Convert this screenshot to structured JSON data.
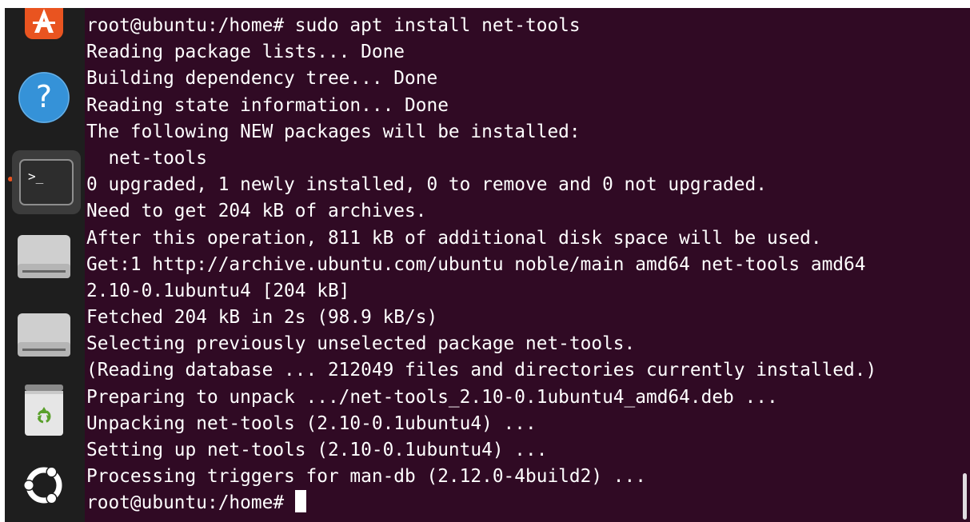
{
  "dock": {
    "items": [
      {
        "name": "app-center",
        "icon": "app-center-icon"
      },
      {
        "name": "help",
        "icon": "help-icon",
        "glyph": "?"
      },
      {
        "name": "terminal",
        "icon": "terminal-icon",
        "glyph": ">_",
        "active": true
      },
      {
        "name": "drive-1",
        "icon": "drive-icon"
      },
      {
        "name": "drive-2",
        "icon": "drive-icon"
      },
      {
        "name": "trash",
        "icon": "trash-icon"
      },
      {
        "name": "show-apps",
        "icon": "ubuntu-logo-icon"
      }
    ]
  },
  "terminal": {
    "prompt": "root@ubuntu:/home# ",
    "lines": [
      "root@ubuntu:/home# sudo apt install net-tools",
      "Reading package lists... Done",
      "Building dependency tree... Done",
      "Reading state information... Done",
      "The following NEW packages will be installed:",
      "  net-tools",
      "0 upgraded, 1 newly installed, 0 to remove and 0 not upgraded.",
      "Need to get 204 kB of archives.",
      "After this operation, 811 kB of additional disk space will be used.",
      "Get:1 http://archive.ubuntu.com/ubuntu noble/main amd64 net-tools amd64",
      "2.10-0.1ubuntu4 [204 kB]",
      "Fetched 204 kB in 2s (98.9 kB/s)",
      "Selecting previously unselected package net-tools.",
      "(Reading database ... 212049 files and directories currently installed.)",
      "Preparing to unpack .../net-tools_2.10-0.1ubuntu4_amd64.deb ...",
      "Unpacking net-tools (2.10-0.1ubuntu4) ...",
      "Setting up net-tools (2.10-0.1ubuntu4) ...",
      "Processing triggers for man-db (2.12.0-4build2) ..."
    ]
  },
  "colors": {
    "terminal_bg": "#300a24",
    "dock_bg": "#1e1e1e",
    "accent": "#e95420"
  }
}
